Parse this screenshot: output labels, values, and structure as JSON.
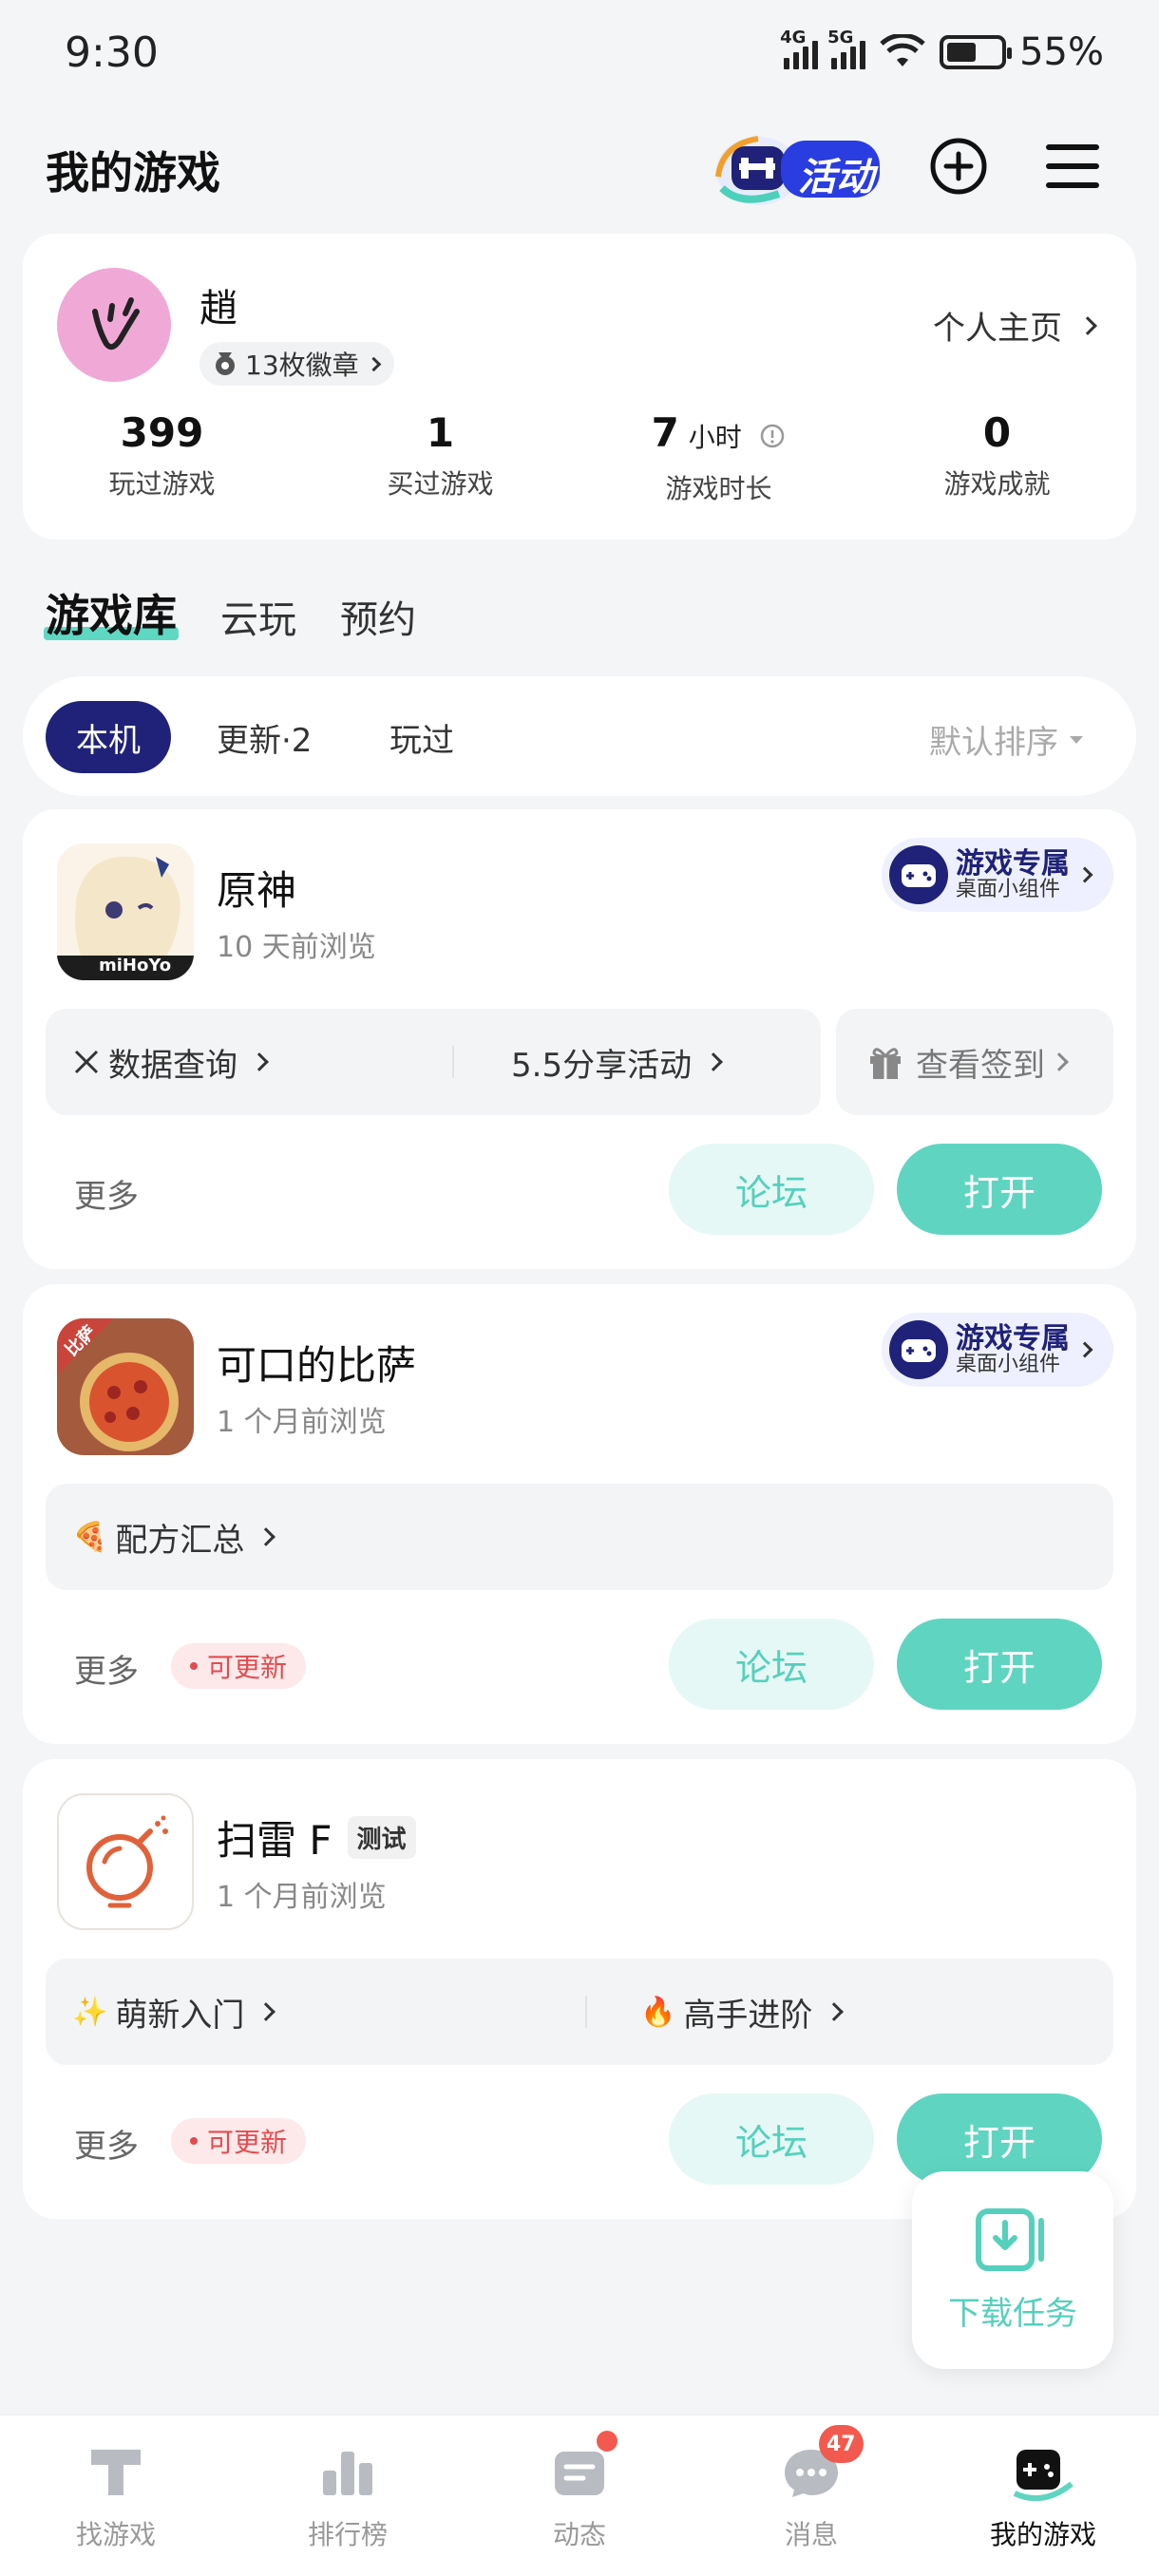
{
  "status_bar": {
    "time": "9:30",
    "net1": "4G",
    "net2": "5G",
    "battery": "55%"
  },
  "header": {
    "title": "我的游戏",
    "activity_label": "活动"
  },
  "profile": {
    "name": "趙",
    "badges": "13枚徽章",
    "homepage": "个人主页",
    "stats": [
      {
        "value": "399",
        "unit": "",
        "label": "玩过游戏"
      },
      {
        "value": "1",
        "unit": "",
        "label": "买过游戏"
      },
      {
        "value": "7",
        "unit": "小时",
        "label": "游戏时长"
      },
      {
        "value": "0",
        "unit": "",
        "label": "游戏成就"
      }
    ]
  },
  "tabs": [
    "游戏库",
    "云玩",
    "预约"
  ],
  "filters": {
    "items": [
      "本机",
      "更新·2",
      "玩过"
    ],
    "sort": "默认排序"
  },
  "widget": {
    "title": "游戏专属",
    "sub": "桌面小组件"
  },
  "games": [
    {
      "name": "原神",
      "tag": "",
      "sub": "10 天前浏览",
      "icon_text": "miHoYo",
      "quick": [
        "数据查询",
        "5.5分享活动"
      ],
      "signin": "查看签到",
      "more": "更多",
      "update": "",
      "forum": "论坛",
      "open": "打开"
    },
    {
      "name": "可口的比萨",
      "tag": "",
      "sub": "1 个月前浏览",
      "icon_text": "比萨",
      "quick": [
        "配方汇总"
      ],
      "more": "更多",
      "update": "可更新",
      "forum": "论坛",
      "open": "打开"
    },
    {
      "name": "扫雷 F",
      "tag": "测试",
      "sub": "1 个月前浏览",
      "quick": [
        "萌新入门",
        "高手进阶"
      ],
      "more": "更多",
      "update": "可更新",
      "forum": "论坛",
      "open": "打开"
    }
  ],
  "download": {
    "label": "下载任务"
  },
  "bottom_nav": {
    "items": [
      "找游戏",
      "排行榜",
      "动态",
      "消息",
      "我的游戏"
    ],
    "message_badge": "47"
  },
  "colors": {
    "accent": "#5fd5c1",
    "navy": "#1f2278",
    "update_red": "#e24c4f"
  }
}
